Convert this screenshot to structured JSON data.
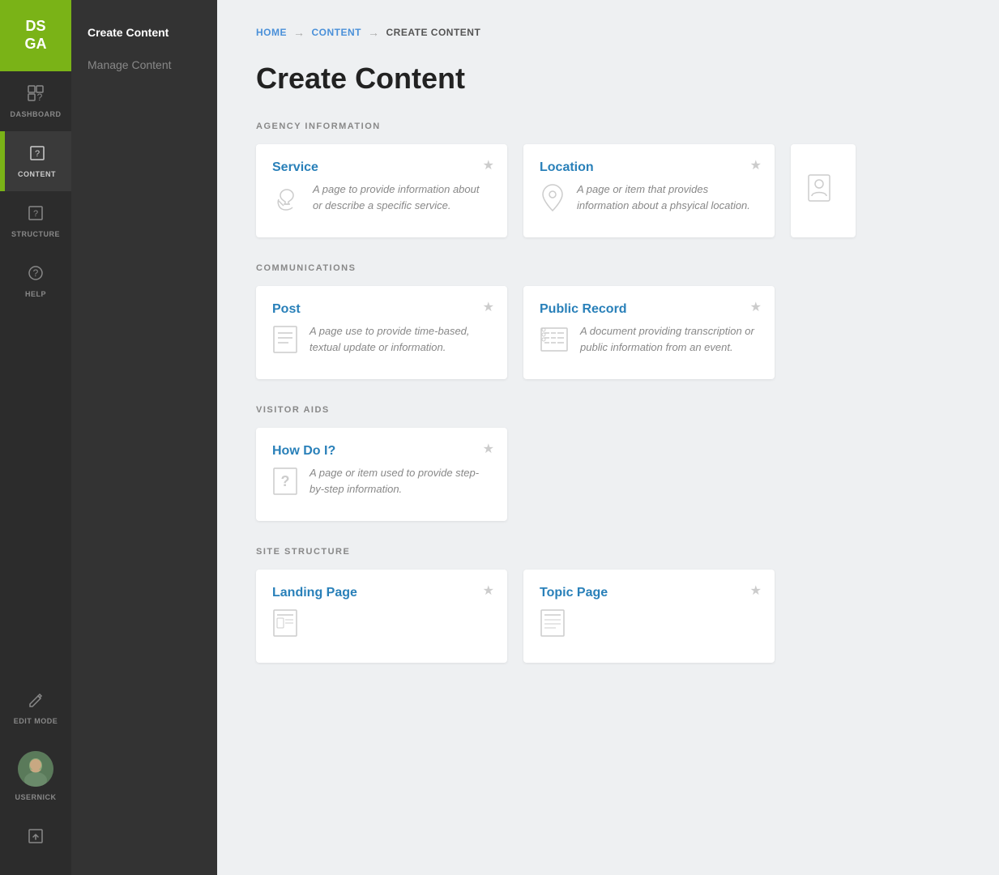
{
  "logo": {
    "text": "DS\nGA"
  },
  "iconSidebar": {
    "items": [
      {
        "id": "dashboard",
        "label": "DASHBOARD",
        "icon": "⊞",
        "active": false
      },
      {
        "id": "content",
        "label": "CONTENT",
        "active": true
      },
      {
        "id": "structure",
        "label": "STRUCTURE",
        "active": false
      },
      {
        "id": "help",
        "label": "HELP",
        "active": false
      }
    ],
    "bottom": [
      {
        "id": "edit-mode",
        "label": "EDIT MODE",
        "icon": "✎"
      },
      {
        "id": "usernick",
        "label": "USERNICK"
      },
      {
        "id": "upload",
        "icon": "⬆"
      }
    ]
  },
  "subSidebar": {
    "items": [
      {
        "id": "create-content",
        "label": "Create Content",
        "active": true
      },
      {
        "id": "manage-content",
        "label": "Manage Content",
        "active": false
      }
    ]
  },
  "breadcrumb": {
    "home": "HOME",
    "content": "CONTENT",
    "current": "CREATE CONTENT",
    "arrow": "→"
  },
  "pageTitle": "Create Content",
  "sections": [
    {
      "id": "agency-information",
      "label": "AGENCY INFORMATION",
      "cards": [
        {
          "id": "service",
          "title": "Service",
          "description": "A page to provide information about or describe a specific service.",
          "icon": "service"
        },
        {
          "id": "location",
          "title": "Location",
          "description": "A page or item that provides information about a phsyical location.",
          "icon": "location"
        },
        {
          "id": "person-partial",
          "title": "",
          "description": "",
          "icon": "person",
          "partial": true
        }
      ]
    },
    {
      "id": "communications",
      "label": "COMMUNICATIONS",
      "cards": [
        {
          "id": "post",
          "title": "Post",
          "description": "A page use to provide time-based, textual update or information.",
          "icon": "post"
        },
        {
          "id": "public-record",
          "title": "Public Record",
          "description": "A document providing transcription or public information from an event.",
          "icon": "public-record"
        }
      ]
    },
    {
      "id": "visitor-aids",
      "label": "VISITOR AIDS",
      "cards": [
        {
          "id": "how-do-i",
          "title": "How Do I?",
          "description": "A page or item used to provide step-by-step information.",
          "icon": "question"
        }
      ]
    },
    {
      "id": "site-structure",
      "label": "SITE STRUCTURE",
      "cards": [
        {
          "id": "landing-page",
          "title": "Landing Page",
          "description": "",
          "icon": "landing"
        },
        {
          "id": "topic-page",
          "title": "Topic Page",
          "description": "",
          "icon": "topic"
        }
      ]
    }
  ]
}
